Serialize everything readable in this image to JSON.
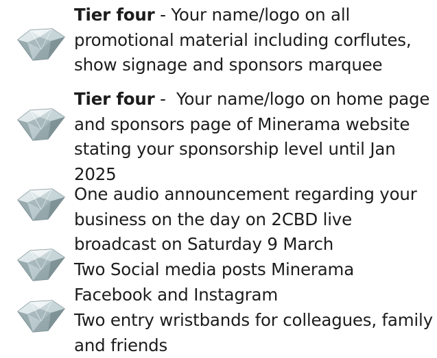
{
  "items": [
    {
      "lead": "Tier four",
      "sep": " - ",
      "body": "Your name/logo on all promotional material including corflutes, show signage and sponsors marquee",
      "icon": "diamond-icon"
    },
    {
      "lead": "Tier four",
      "sep": " -  ",
      "body": "Your name/logo on home page and sponsors page of Minerama website stating your sponsorship level until Jan 2025",
      "icon": "diamond-icon"
    },
    {
      "lead": "",
      "sep": "",
      "body": "One audio announcement regarding your business on the day on 2CBD live broadcast on Saturday 9 March",
      "icon": "diamond-icon"
    },
    {
      "lead": "",
      "sep": "",
      "body": "Two Social media posts Minerama Facebook and Instagram",
      "icon": "diamond-icon"
    },
    {
      "lead": "",
      "sep": "",
      "body": "Two entry wristbands for colleagues, family and friends",
      "icon": "diamond-icon"
    }
  ],
  "colors": {
    "text": "#1c1c1c",
    "gem_light": "#e9f1f2",
    "gem_mid": "#aebfc2",
    "gem_dark": "#5f7377"
  }
}
